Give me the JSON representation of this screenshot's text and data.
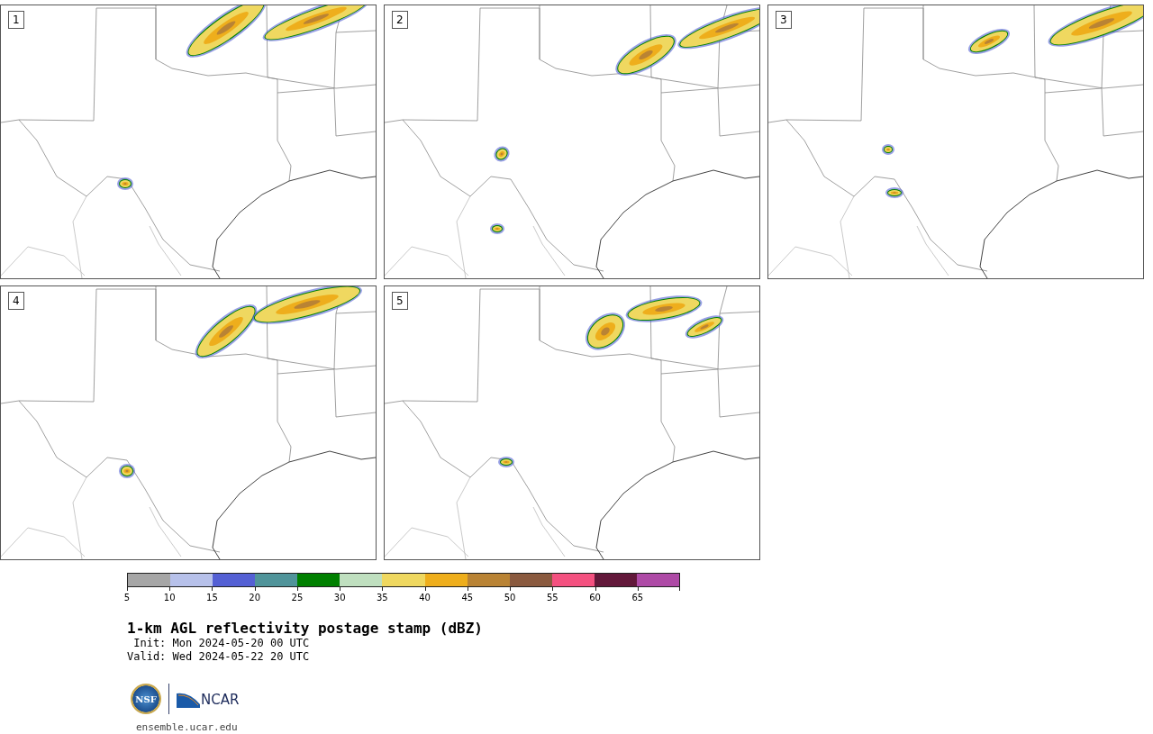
{
  "panels": [
    {
      "label": "1"
    },
    {
      "label": "2"
    },
    {
      "label": "3"
    },
    {
      "label": "4"
    },
    {
      "label": "5"
    }
  ],
  "colorbar": {
    "bins": [
      {
        "color": "#a6a6a6"
      },
      {
        "color": "#b7c1ea"
      },
      {
        "color": "#5460d4"
      },
      {
        "color": "#50949a"
      },
      {
        "color": "#008000"
      },
      {
        "color": "#bfdfbf"
      },
      {
        "color": "#efd860"
      },
      {
        "color": "#eeae1c"
      },
      {
        "color": "#b98334"
      },
      {
        "color": "#8a5a3f"
      },
      {
        "color": "#f45180"
      },
      {
        "color": "#62183a"
      },
      {
        "color": "#ae4aa6"
      }
    ],
    "ticks": [
      "5",
      "10",
      "15",
      "20",
      "25",
      "30",
      "35",
      "40",
      "45",
      "50",
      "55",
      "60",
      "65"
    ]
  },
  "title": "1-km AGL reflectivity postage stamp (dBZ)",
  "init": " Init: Mon 2024-05-20 00 UTC",
  "valid": "Valid: Wed 2024-05-22 20 UTC",
  "logos": {
    "nsf": "NSF",
    "ncar": "NCAR"
  },
  "url": "ensemble.ucar.edu"
}
